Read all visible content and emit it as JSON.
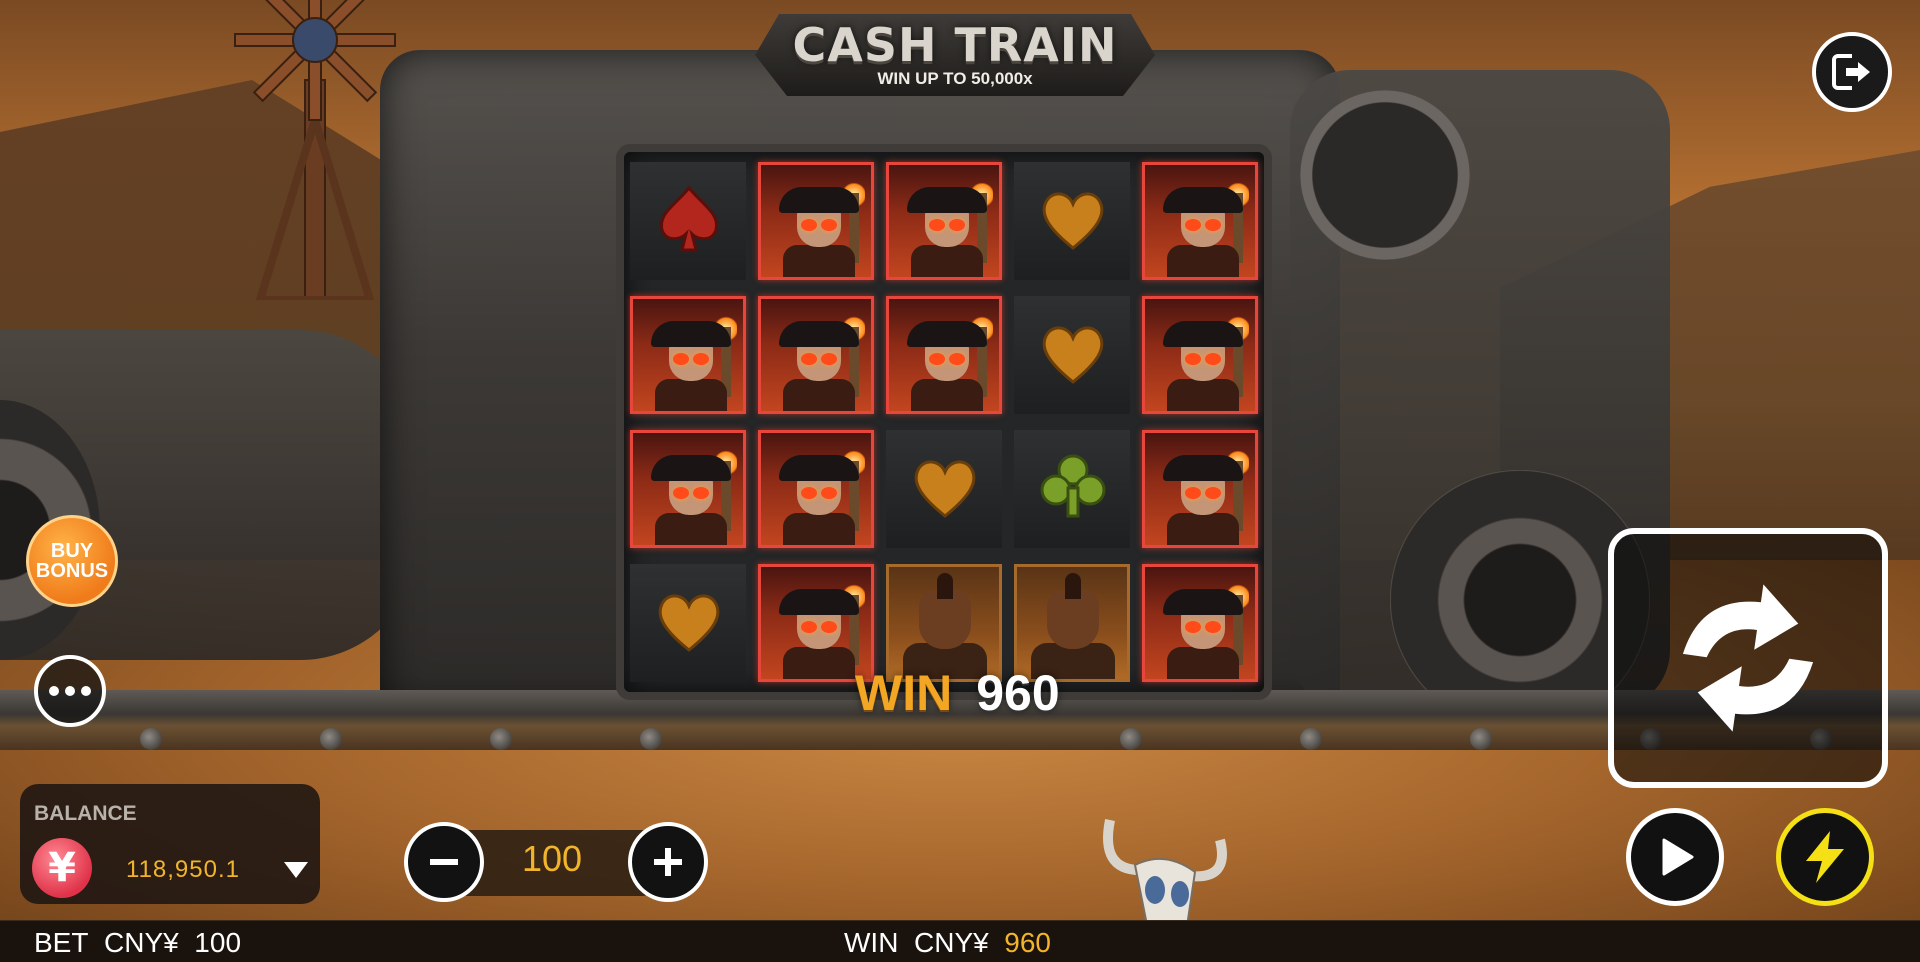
{
  "game": {
    "title": "CASH TRAIN",
    "subtitle": "WIN UP TO 50,000x"
  },
  "reels": {
    "columns": [
      [
        "red-spade",
        "outlaw",
        "outlaw",
        "gold-heart"
      ],
      [
        "outlaw",
        "outlaw",
        "outlaw",
        "outlaw"
      ],
      [
        "outlaw",
        "outlaw",
        "gold-heart",
        "bandit"
      ],
      [
        "gold-heart",
        "gold-heart",
        "green-club",
        "bandit"
      ],
      [
        "outlaw",
        "outlaw",
        "outlaw",
        "outlaw"
      ]
    ]
  },
  "win_display": {
    "label": "WIN",
    "amount": "960"
  },
  "controls": {
    "buy_bonus_line1": "BUY",
    "buy_bonus_line2": "BONUS",
    "exit_icon": "exit-icon",
    "more_icon": "more-icon",
    "spin_icon": "spin-icon",
    "autoplay_icon": "play-icon",
    "turbo_icon": "lightning-icon"
  },
  "balance": {
    "title": "BALANCE",
    "currency_symbol": "¥",
    "value": "118,950.1"
  },
  "bet": {
    "value": "100"
  },
  "footer": {
    "bet_label": "BET",
    "bet_currency": "CNY¥",
    "bet_amount": "100",
    "win_label": "WIN",
    "win_currency": "CNY¥",
    "win_amount": "960"
  },
  "colors": {
    "accent_gold": "#f2b42a",
    "win_orange": "#f2a623",
    "highlight_red": "#e6463c",
    "turbo_yellow": "#f4e014"
  }
}
